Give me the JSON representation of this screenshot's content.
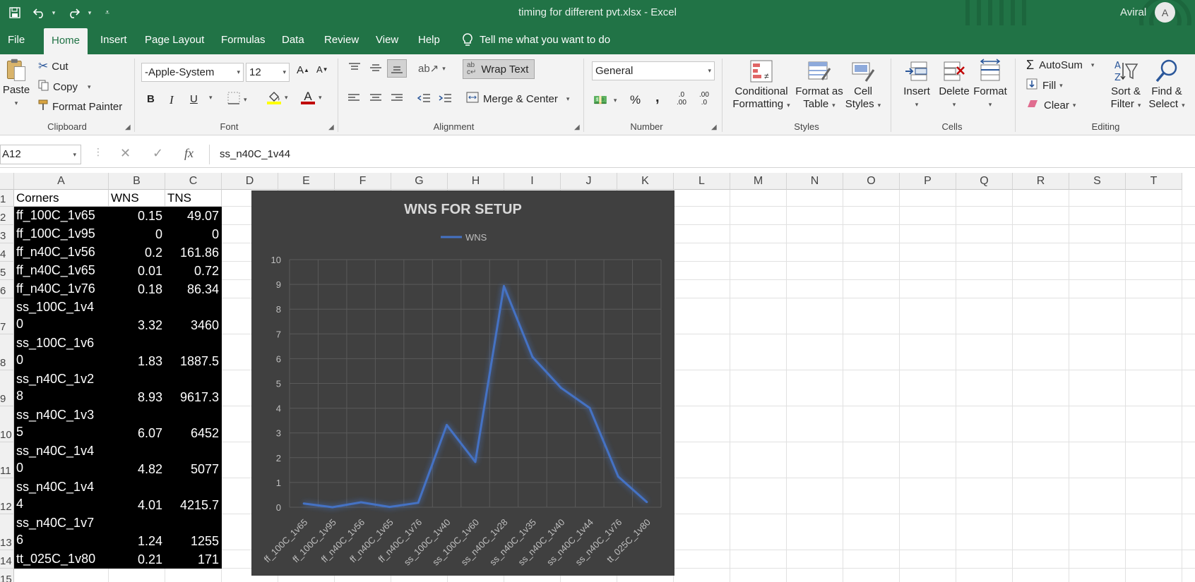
{
  "window": {
    "title": "timing for different pvt.xlsx  -  Excel",
    "user_name": "Aviral",
    "user_initial": "A"
  },
  "quick_access": {
    "save_icon": "save-icon",
    "undo_icon": "undo-icon",
    "redo_icon": "redo-icon",
    "customize_icon": "customize-qat-icon"
  },
  "tabs": [
    "File",
    "Home",
    "Insert",
    "Page Layout",
    "Formulas",
    "Data",
    "Review",
    "View",
    "Help"
  ],
  "active_tab": "Home",
  "tell_me": "Tell me what you want to do",
  "ribbon": {
    "clipboard": {
      "label": "Clipboard",
      "paste": "Paste",
      "cut": "Cut",
      "copy": "Copy",
      "format_painter": "Format Painter"
    },
    "font": {
      "label": "Font",
      "font_name": "-Apple-System",
      "font_size": "12",
      "bold": "B",
      "italic": "I",
      "underline": "U",
      "grow": "A",
      "shrink": "A",
      "font_color_letter": "A",
      "fill_color": "#ffff00",
      "font_color": "#c00000"
    },
    "alignment": {
      "label": "Alignment",
      "wrap_text": "Wrap Text",
      "merge_center": "Merge & Center"
    },
    "number": {
      "label": "Number",
      "format": "General",
      "percent": "%",
      "comma": ",",
      "inc_decimal_a": ".0",
      "inc_decimal_b": ".00",
      "dec_decimal_a": ".00",
      "dec_decimal_b": ".0"
    },
    "styles": {
      "label": "Styles",
      "conditional_formatting": [
        "Conditional",
        "Formatting"
      ],
      "format_as_table": [
        "Format as",
        "Table"
      ],
      "cell_styles": [
        "Cell",
        "Styles"
      ]
    },
    "cells": {
      "label": "Cells",
      "insert": "Insert",
      "delete": "Delete",
      "format": "Format"
    },
    "editing": {
      "label": "Editing",
      "autosum": "AutoSum",
      "fill": "Fill",
      "clear": "Clear",
      "sort_filter": [
        "Sort &",
        "Filter"
      ],
      "find_select": [
        "Find &",
        "Select"
      ]
    }
  },
  "formula_bar": {
    "name_box": "A12",
    "cancel": "✕",
    "enter": "✓",
    "fx": "fx",
    "value": "ss_n40C_1v44"
  },
  "sheet": {
    "columns": [
      "A",
      "B",
      "C",
      "D",
      "E",
      "F",
      "G",
      "H",
      "I",
      "J",
      "K",
      "L",
      "M",
      "N",
      "O",
      "P",
      "Q",
      "R",
      "S",
      "T"
    ],
    "rows": [
      "1",
      "2",
      "3",
      "4",
      "5",
      "6",
      "7",
      "8",
      "9",
      "10",
      "11",
      "12",
      "13",
      "14",
      "15"
    ],
    "headers": [
      "Corners",
      "WNS",
      "TNS"
    ],
    "data": [
      [
        "ff_100C_1v65",
        "0.15",
        "49.07"
      ],
      [
        "ff_100C_1v95",
        "0",
        "0"
      ],
      [
        "ff_n40C_1v56",
        "0.2",
        "161.86"
      ],
      [
        "ff_n40C_1v65",
        "0.01",
        "0.72"
      ],
      [
        "ff_n40C_1v76",
        "0.18",
        "86.34"
      ],
      [
        "ss_100C_1v4\n0",
        "3.32",
        "3460"
      ],
      [
        "ss_100C_1v6\n0",
        "1.83",
        "1887.5"
      ],
      [
        "ss_n40C_1v2\n8",
        "8.93",
        "9617.3"
      ],
      [
        "ss_n40C_1v3\n5",
        "6.07",
        "6452"
      ],
      [
        "ss_n40C_1v4\n0",
        "4.82",
        "5077"
      ],
      [
        "ss_n40C_1v4\n4",
        "4.01",
        "4215.7"
      ],
      [
        "ss_n40C_1v7\n6",
        "1.24",
        "1255"
      ],
      [
        "tt_025C_1v80",
        "0.21",
        "171"
      ]
    ]
  },
  "chart_data": {
    "type": "line",
    "title": "WNS FOR SETUP",
    "categories": [
      "ff_100C_1v65",
      "ff_100C_1v95",
      "ff_n40C_1v56",
      "ff_n40C_1v65",
      "ff_n40C_1v76",
      "ss_100C_1v40",
      "ss_100C_1v60",
      "ss_n40C_1v28",
      "ss_n40C_1v35",
      "ss_n40C_1v40",
      "ss_n40C_1v44",
      "ss_n40C_1v76",
      "tt_025C_1v80"
    ],
    "series": [
      {
        "name": "WNS",
        "values": [
          0.15,
          0,
          0.2,
          0.01,
          0.18,
          3.32,
          1.83,
          8.93,
          6.07,
          4.82,
          4.01,
          1.24,
          0.21
        ]
      }
    ],
    "ylim": [
      0,
      10
    ],
    "yticks": [
      "0",
      "1",
      "2",
      "3",
      "4",
      "5",
      "6",
      "7",
      "8",
      "9",
      "10"
    ],
    "legend": "top",
    "grid": true,
    "line_color": "#4472c4",
    "background": "#404040"
  }
}
